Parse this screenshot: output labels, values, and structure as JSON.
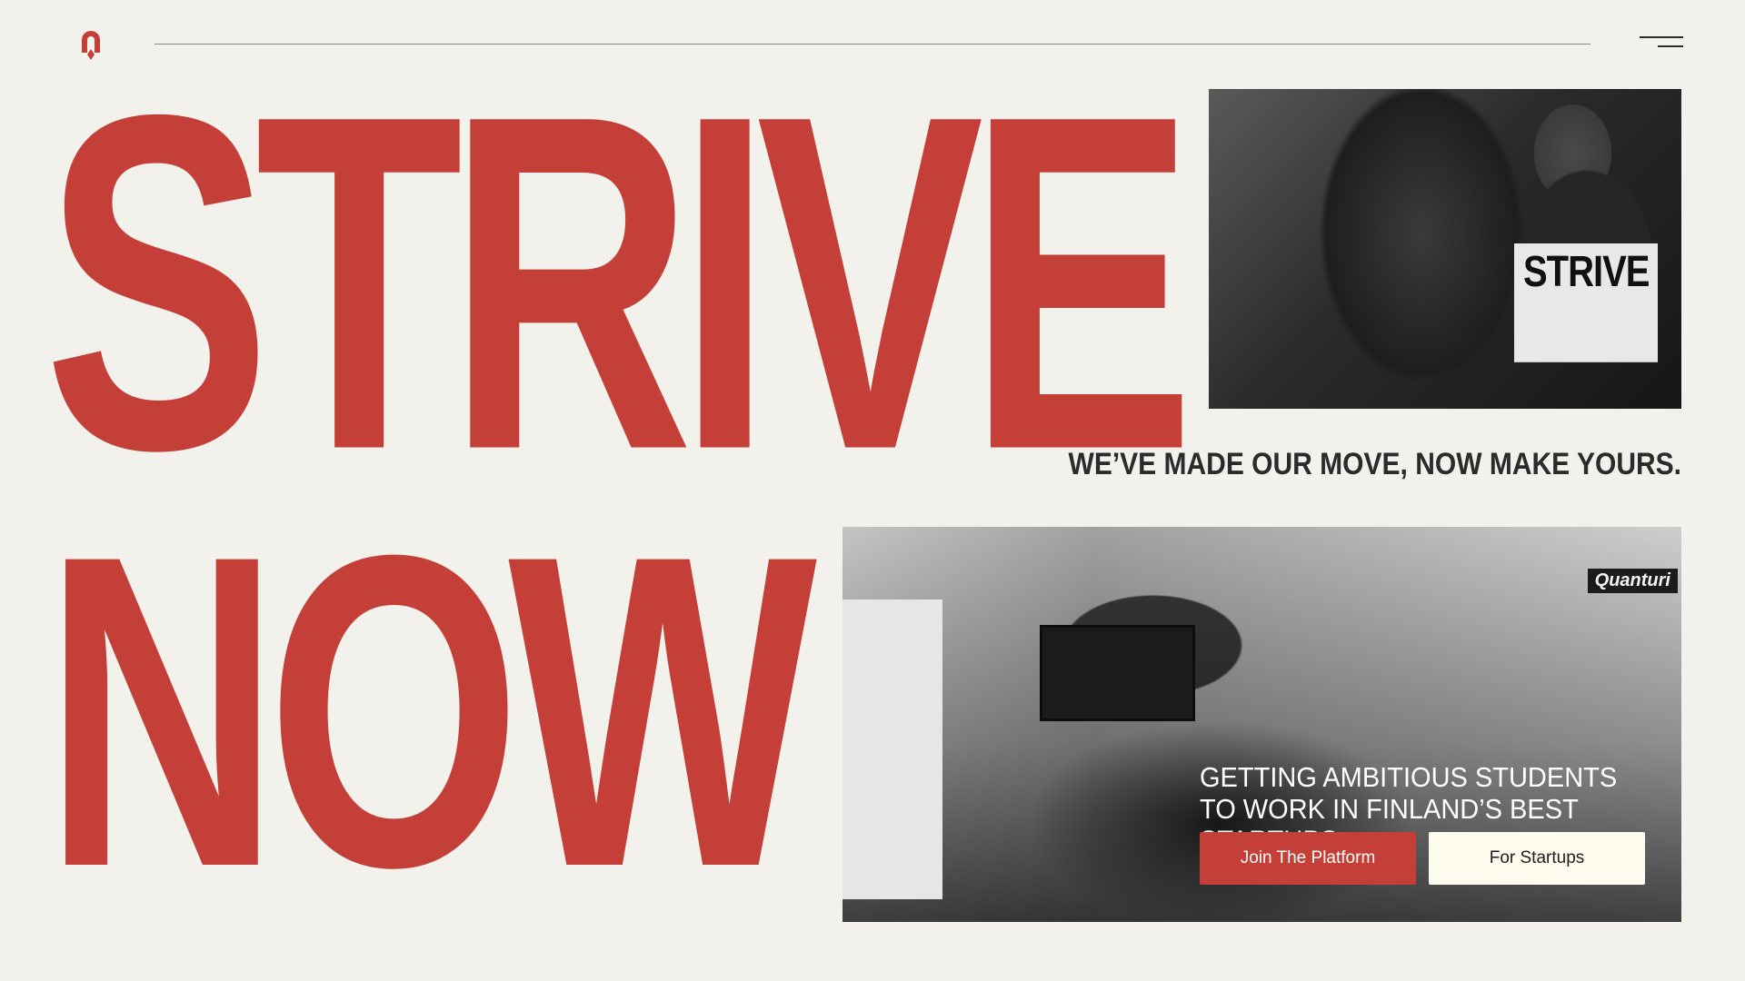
{
  "brand": {
    "logo_icon": "arch-pin-logo-icon",
    "accent_color": "#c33f37"
  },
  "header": {
    "menu_icon": "hamburger-menu-icon"
  },
  "hero": {
    "line1": "STRIVE",
    "line2": "NOW",
    "tagline": "WE’VE MADE OUR MOVE, NOW MAKE YOURS.",
    "top_photo_shirt_text": "STRIVE",
    "bottom_photo_sign": "Quanturi",
    "headline": "GETTING AMBITIOUS STUDENTS TO WORK IN FINLAND’S BEST STARTUPS.",
    "buttons": {
      "join": "Join The Platform",
      "startups": "For Startups"
    }
  },
  "colors": {
    "background": "#f2f1ec",
    "primary": "#c33f37",
    "secondary_button": "#fdfbee",
    "text_dark": "#2b2b2b"
  }
}
